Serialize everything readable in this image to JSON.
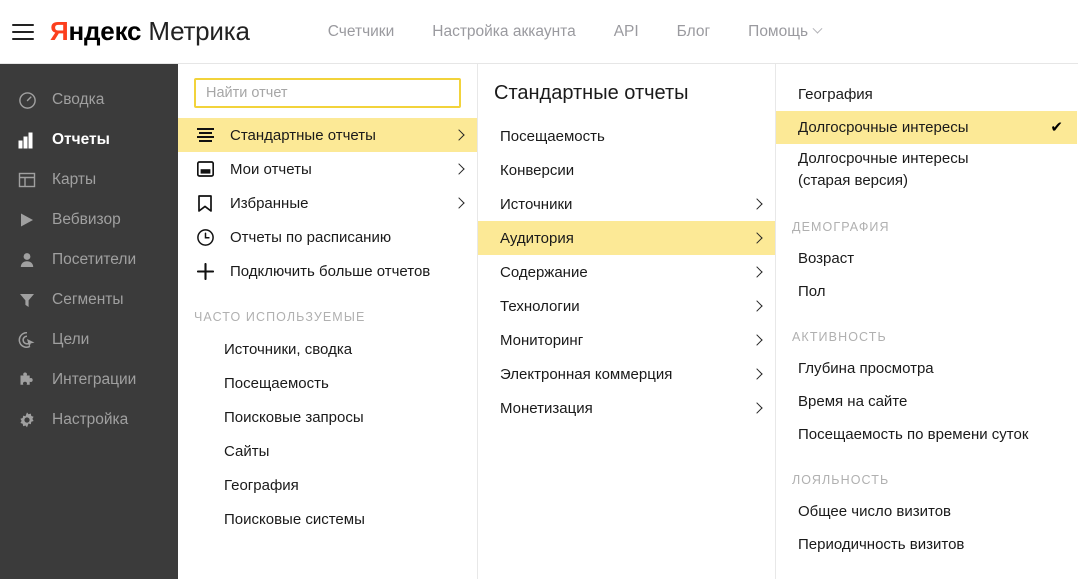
{
  "header": {
    "menu_icon": "hamburger-icon",
    "brand_first": "Яндекс",
    "brand_first_initial": "Я",
    "brand_first_rest": "ндекс",
    "brand_second": "Метрика",
    "nav": [
      {
        "label": "Счетчики",
        "icon": null
      },
      {
        "label": "Настройка аккаунта",
        "icon": null
      },
      {
        "label": "API",
        "icon": null
      },
      {
        "label": "Блог",
        "icon": null
      },
      {
        "label": "Помощь",
        "icon": "chevron-down-icon"
      }
    ]
  },
  "sidebar": {
    "items": [
      {
        "label": "Сводка",
        "icon": "speedometer-icon",
        "active": false
      },
      {
        "label": "Отчеты",
        "icon": "bar-chart-icon",
        "active": true
      },
      {
        "label": "Карты",
        "icon": "layout-map-icon",
        "active": false
      },
      {
        "label": "Вебвизор",
        "icon": "play-icon",
        "active": false
      },
      {
        "label": "Посетители",
        "icon": "person-icon",
        "active": false
      },
      {
        "label": "Сегменты",
        "icon": "funnel-icon",
        "active": false
      },
      {
        "label": "Цели",
        "icon": "target-cursor-icon",
        "active": false
      },
      {
        "label": "Интеграции",
        "icon": "puzzle-icon",
        "active": false
      },
      {
        "label": "Настройка",
        "icon": "gear-icon",
        "active": false
      }
    ]
  },
  "panel1": {
    "search": {
      "value": "",
      "placeholder": "Найти отчет"
    },
    "items": [
      {
        "label": "Стандартные отчеты",
        "icon": "list-lines-icon",
        "chevron": true,
        "highlighted": true
      },
      {
        "label": "Мои отчеты",
        "icon": "inbox-icon",
        "chevron": true,
        "highlighted": false
      },
      {
        "label": "Избранные",
        "icon": "bookmark-icon",
        "chevron": true,
        "highlighted": false
      },
      {
        "label": "Отчеты по расписанию",
        "icon": "clock-icon",
        "chevron": false,
        "highlighted": false
      },
      {
        "label": "Подключить больше отчетов",
        "icon": "plus-icon",
        "chevron": false,
        "highlighted": false
      }
    ],
    "frequent_title": "ЧАСТО ИСПОЛЬЗУЕМЫЕ",
    "frequent": [
      {
        "label": "Источники, сводка"
      },
      {
        "label": "Посещаемость"
      },
      {
        "label": "Поисковые запросы"
      },
      {
        "label": "Сайты"
      },
      {
        "label": "География"
      },
      {
        "label": "Поисковые системы"
      }
    ]
  },
  "panel2": {
    "title": "Стандартные отчеты",
    "items": [
      {
        "label": "Посещаемость",
        "chevron": false,
        "highlighted": false
      },
      {
        "label": "Конверсии",
        "chevron": false,
        "highlighted": false
      },
      {
        "label": "Источники",
        "chevron": true,
        "highlighted": false
      },
      {
        "label": "Аудитория",
        "chevron": true,
        "highlighted": true
      },
      {
        "label": "Содержание",
        "chevron": true,
        "highlighted": false
      },
      {
        "label": "Технологии",
        "chevron": true,
        "highlighted": false
      },
      {
        "label": "Мониторинг",
        "chevron": true,
        "highlighted": false
      },
      {
        "label": "Электронная коммерция",
        "chevron": true,
        "highlighted": false
      },
      {
        "label": "Монетизация",
        "chevron": true,
        "highlighted": false
      }
    ]
  },
  "panel3": {
    "items": [
      {
        "kind": "item",
        "label": "География",
        "highlighted": false,
        "checked": false,
        "twoline": false
      },
      {
        "kind": "item",
        "label": "Долгосрочные интересы",
        "highlighted": true,
        "checked": true,
        "twoline": false
      },
      {
        "kind": "item",
        "label": "Долгосрочные интересы (старая версия)",
        "highlighted": false,
        "checked": false,
        "twoline": true
      },
      {
        "kind": "group",
        "label": "ДЕМОГРАФИЯ"
      },
      {
        "kind": "item",
        "label": "Возраст",
        "highlighted": false,
        "checked": false,
        "twoline": false
      },
      {
        "kind": "item",
        "label": "Пол",
        "highlighted": false,
        "checked": false,
        "twoline": false
      },
      {
        "kind": "group",
        "label": "АКТИВНОСТЬ"
      },
      {
        "kind": "item",
        "label": "Глубина просмотра",
        "highlighted": false,
        "checked": false,
        "twoline": false
      },
      {
        "kind": "item",
        "label": "Время на сайте",
        "highlighted": false,
        "checked": false,
        "twoline": false
      },
      {
        "kind": "item",
        "label": "Посещаемость по времени суток",
        "highlighted": false,
        "checked": false,
        "twoline": false
      },
      {
        "kind": "group",
        "label": "ЛОЯЛЬНОСТЬ"
      },
      {
        "kind": "item",
        "label": "Общее число визитов",
        "highlighted": false,
        "checked": false,
        "twoline": false
      },
      {
        "kind": "item",
        "label": "Периодичность визитов",
        "highlighted": false,
        "checked": false,
        "twoline": false
      }
    ],
    "check_glyph": "✔"
  },
  "colors": {
    "brand_red": "#fc3f1d",
    "highlight_yellow": "#fce996",
    "search_border_yellow": "#f2d33b",
    "sidebar_bg": "#3b3b3b",
    "sidebar_text": "#a0a0a0",
    "topnav_text": "#9a9a9f",
    "group_label": "#b0b0b0"
  }
}
